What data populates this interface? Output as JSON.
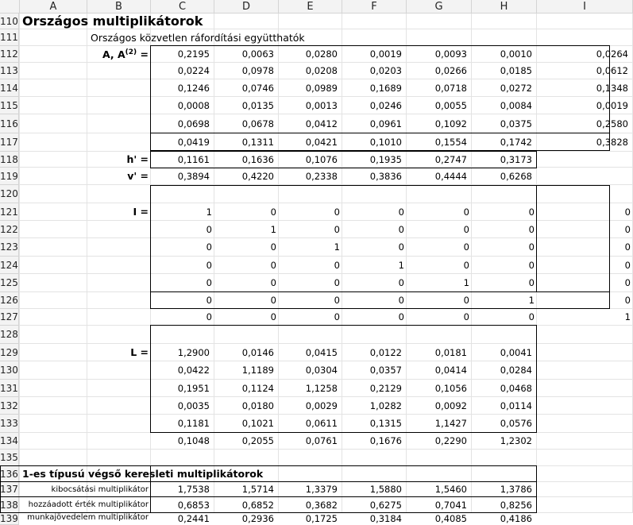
{
  "columns": [
    "A",
    "B",
    "C",
    "D",
    "E",
    "F",
    "G",
    "H",
    "I"
  ],
  "rows": [
    "110",
    "111",
    "112",
    "113",
    "114",
    "115",
    "116",
    "117",
    "118",
    "119",
    "120",
    "121",
    "122",
    "123",
    "124",
    "125",
    "126",
    "127",
    "128",
    "129",
    "130",
    "131",
    "132",
    "133",
    "134",
    "135",
    "136",
    "137",
    "138",
    "139"
  ],
  "title": "Országos multiplikátorok",
  "subtitle": "Országos közvetlen ráfordítási együtthatók",
  "labels": {
    "A": "A, A",
    "A_sup": "(2)",
    "A_eq": " =",
    "h": "h' =",
    "v": "v' =",
    "I": "I =",
    "L": "L =",
    "section2": "1-es típusú végső keresleti multiplikátorok"
  },
  "A_matrix": [
    [
      "0,2195",
      "0,0063",
      "0,0280",
      "0,0019",
      "0,0093",
      "0,0010",
      "0,0264"
    ],
    [
      "0,0224",
      "0,0978",
      "0,0208",
      "0,0203",
      "0,0266",
      "0,0185",
      "0,0612"
    ],
    [
      "0,1246",
      "0,0746",
      "0,0989",
      "0,1689",
      "0,0718",
      "0,0272",
      "0,1348"
    ],
    [
      "0,0008",
      "0,0135",
      "0,0013",
      "0,0246",
      "0,0055",
      "0,0084",
      "0,0019"
    ],
    [
      "0,0698",
      "0,0678",
      "0,0412",
      "0,0961",
      "0,1092",
      "0,0375",
      "0,2580"
    ],
    [
      "0,0419",
      "0,1311",
      "0,0421",
      "0,1010",
      "0,1554",
      "0,1742",
      "0,3828"
    ]
  ],
  "h_vector": [
    "0,1161",
    "0,1636",
    "0,1076",
    "0,1935",
    "0,2747",
    "0,3173"
  ],
  "v_vector": [
    "0,3894",
    "0,4220",
    "0,2338",
    "0,3836",
    "0,4444",
    "0,6268"
  ],
  "I_matrix": [
    [
      "1",
      "0",
      "0",
      "0",
      "0",
      "0",
      "0"
    ],
    [
      "0",
      "1",
      "0",
      "0",
      "0",
      "0",
      "0"
    ],
    [
      "0",
      "0",
      "1",
      "0",
      "0",
      "0",
      "0"
    ],
    [
      "0",
      "0",
      "0",
      "1",
      "0",
      "0",
      "0"
    ],
    [
      "0",
      "0",
      "0",
      "0",
      "1",
      "0",
      "0"
    ],
    [
      "0",
      "0",
      "0",
      "0",
      "0",
      "1",
      "0"
    ],
    [
      "0",
      "0",
      "0",
      "0",
      "0",
      "0",
      "1"
    ]
  ],
  "L_matrix": [
    [
      "1,2900",
      "0,0146",
      "0,0415",
      "0,0122",
      "0,0181",
      "0,0041"
    ],
    [
      "0,0422",
      "1,1189",
      "0,0304",
      "0,0357",
      "0,0414",
      "0,0284"
    ],
    [
      "0,1951",
      "0,1124",
      "1,1258",
      "0,2129",
      "0,1056",
      "0,0468"
    ],
    [
      "0,0035",
      "0,0180",
      "0,0029",
      "1,0282",
      "0,0092",
      "0,0114"
    ],
    [
      "0,1181",
      "0,1021",
      "0,0611",
      "0,1315",
      "1,1427",
      "0,0576"
    ],
    [
      "0,1048",
      "0,2055",
      "0,0761",
      "0,1676",
      "0,2290",
      "1,2302"
    ]
  ],
  "multipliers": [
    {
      "label": "kibocsátási multiplikátor",
      "values": [
        "1,7538",
        "1,5714",
        "1,3379",
        "1,5880",
        "1,5460",
        "1,3786"
      ]
    },
    {
      "label": "hozzáadott érték multiplikátor",
      "values": [
        "0,6853",
        "0,6852",
        "0,3682",
        "0,6275",
        "0,7041",
        "0,8256"
      ]
    },
    {
      "label": "munkajövedelem multiplikátor",
      "values": [
        "0,2441",
        "0,2936",
        "0,1725",
        "0,3184",
        "0,4085",
        "0,4186"
      ]
    }
  ]
}
